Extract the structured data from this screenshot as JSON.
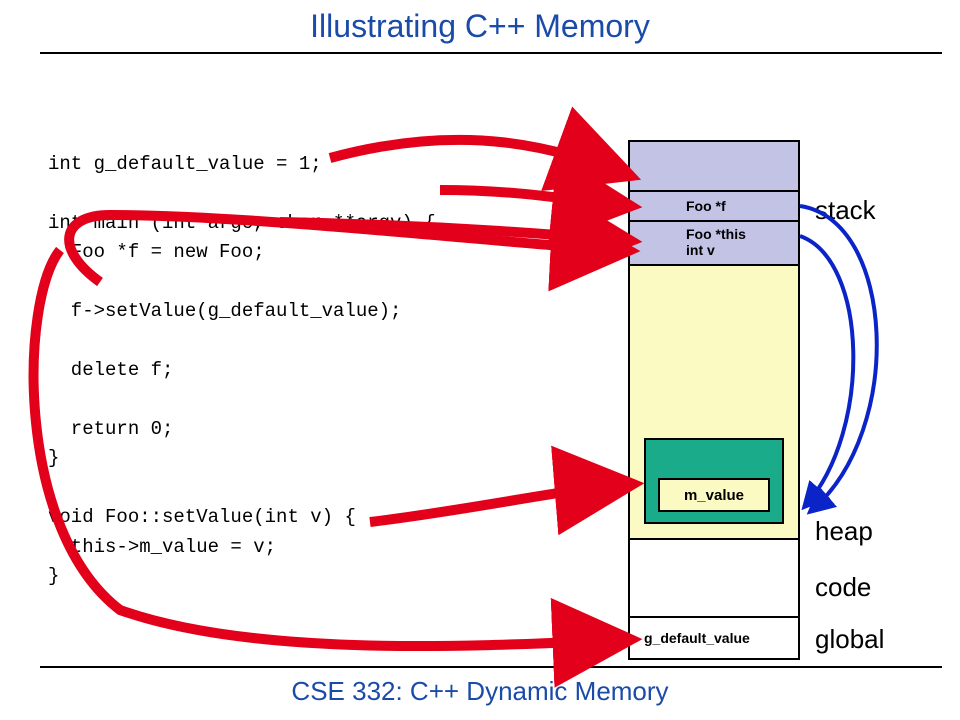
{
  "title": "Illustrating C++ Memory",
  "footer": "CSE 332: C++ Dynamic Memory",
  "code": "int g_default_value = 1;\n\nint main (int argc, char **argv) {\n  Foo *f = new Foo;\n\n  f->setValue(g_default_value);\n\n  delete f;\n\n  return 0;\n}\n\nvoid Foo::setValue(int v) {\n  this->m_value = v;\n}",
  "mem": {
    "stack_f": "Foo *f",
    "stack_this": "Foo *this",
    "stack_v": "int v",
    "heap_box": "m_value",
    "global_box": "g_default_value"
  },
  "labels": {
    "stack": "stack",
    "heap": "heap",
    "code": "code",
    "global": "global"
  }
}
